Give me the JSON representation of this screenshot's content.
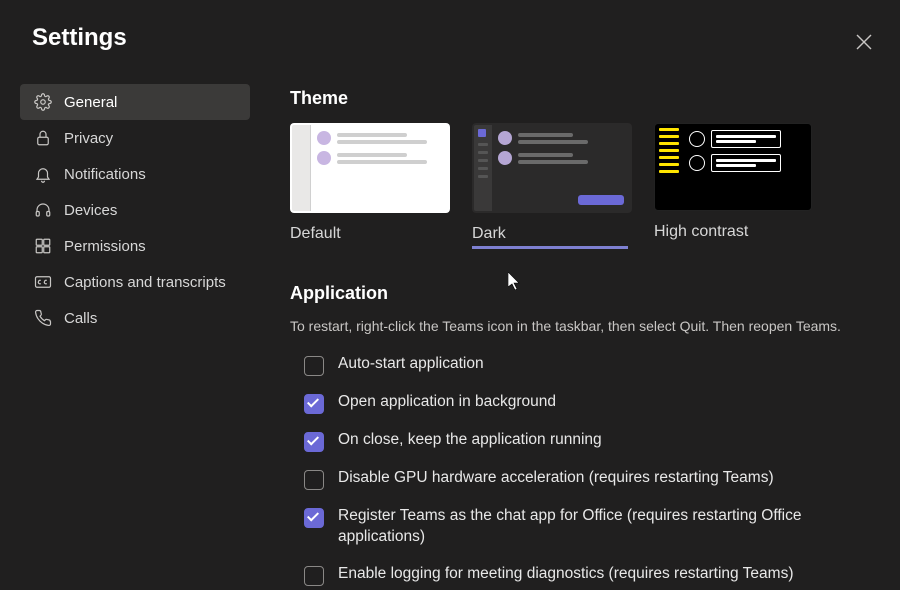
{
  "title": "Settings",
  "sidebar": {
    "items": [
      {
        "label": "General"
      },
      {
        "label": "Privacy"
      },
      {
        "label": "Notifications"
      },
      {
        "label": "Devices"
      },
      {
        "label": "Permissions"
      },
      {
        "label": "Captions and transcripts"
      },
      {
        "label": "Calls"
      }
    ],
    "active_index": 0
  },
  "theme": {
    "section_title": "Theme",
    "options": [
      {
        "label": "Default"
      },
      {
        "label": "Dark"
      },
      {
        "label": "High contrast"
      }
    ],
    "selected_index": 1
  },
  "application": {
    "section_title": "Application",
    "help_text": "To restart, right-click the Teams icon in the taskbar, then select Quit. Then reopen Teams.",
    "checks": [
      {
        "label": "Auto-start application",
        "checked": false
      },
      {
        "label": "Open application in background",
        "checked": true
      },
      {
        "label": "On close, keep the application running",
        "checked": true
      },
      {
        "label": "Disable GPU hardware acceleration (requires restarting Teams)",
        "checked": false
      },
      {
        "label": "Register Teams as the chat app for Office (requires restarting Office applications)",
        "checked": true
      },
      {
        "label": "Enable logging for meeting diagnostics (requires restarting Teams)",
        "checked": false
      }
    ]
  }
}
